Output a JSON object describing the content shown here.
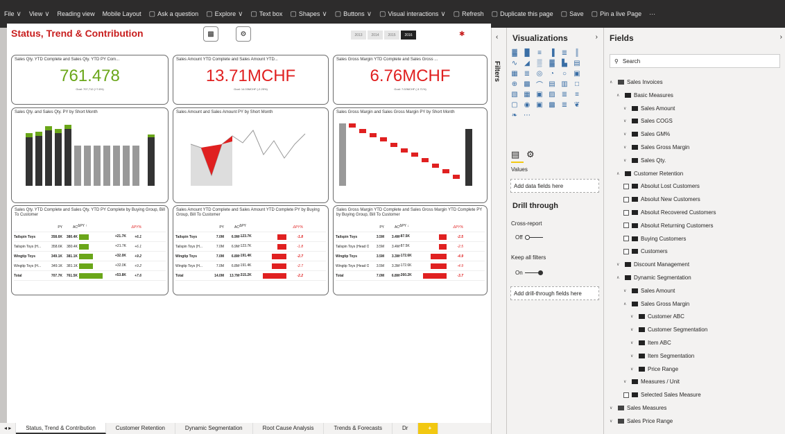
{
  "toolbar": {
    "items": [
      {
        "label": "File",
        "icon": "chevron-down"
      },
      {
        "label": "View",
        "icon": "chevron-down"
      },
      {
        "label": "Reading view"
      },
      {
        "label": "Mobile Layout"
      },
      {
        "label": "Ask a question",
        "icon": "chat"
      },
      {
        "label": "Explore",
        "icon": "explore"
      },
      {
        "label": "Text box",
        "icon": "text"
      },
      {
        "label": "Shapes",
        "icon": "shapes"
      },
      {
        "label": "Buttons",
        "icon": "buttons"
      },
      {
        "label": "Visual interactions",
        "icon": "visual"
      },
      {
        "label": "Refresh",
        "icon": "refresh"
      },
      {
        "label": "Duplicate this page",
        "icon": "duplicate"
      },
      {
        "label": "Save",
        "icon": "save"
      },
      {
        "label": "Pin a live Page",
        "icon": "pin"
      }
    ],
    "more": "···"
  },
  "report": {
    "title": "Status, Trend & Contribution",
    "years": [
      "2013",
      "2014",
      "2015",
      "2016"
    ],
    "selected_year": "2016"
  },
  "cards": [
    {
      "title": "Sales Qty. YTD Complete and Sales Qty. YTD PY Com...",
      "value": "761.478",
      "goal": "Goal: 707,712 (+7.6%)",
      "color": "g"
    },
    {
      "title": "Sales Amount YTD Complete and Sales Amount YTD...",
      "value": "13.71MCHF",
      "goal": "Goal: 14.03MCHF (-2.25%)",
      "color": "r"
    },
    {
      "title": "Sales Gross Margin YTD Complete and Sales Gross ...",
      "value": "6.76MCHF",
      "goal": "Goal: 7.02MCHF (-3.71%)",
      "color": "r"
    }
  ],
  "charts": [
    {
      "title": "Sales Qty. and Sales Qty. PY by Short Month"
    },
    {
      "title": "Sales Amount and Sales Amount PY by Short Month"
    },
    {
      "title": "Sales Gross Margin and Sales Gross Margin PY by Short Month"
    }
  ],
  "tables": [
    {
      "title": "Sales Qty. YTD Complete and Sales Qty. YTD PY Complete by Buying Group, Bill To Customer",
      "headers": [
        "",
        "PY",
        "AC",
        "ΔPY ↑",
        "ΔPY%"
      ],
      "rows": [
        [
          "Tailspin Toys",
          "358.6K",
          "380.4K",
          "+21.7K",
          "+6.1"
        ],
        [
          "Tailspin Toys (H...",
          "358.6K",
          "380.4K",
          "+21.7K",
          "+6.1"
        ],
        [
          "Wingtip Toys",
          "349.1K",
          "381.1K",
          "+32.0K",
          "+9.2"
        ],
        [
          "Wingtip Toys (H...",
          "349.1K",
          "381.1K",
          "+32.0K",
          "+9.2"
        ],
        [
          "Total",
          "707.7K",
          "761.5K",
          "+53.8K",
          "+7.6"
        ]
      ]
    },
    {
      "title": "Sales Amount YTD Complete and Sales Amount YTD Complete PY by Buying Group, Bill To Customer",
      "headers": [
        "",
        "PY",
        "AC",
        "ΔPY",
        "ΔPY%"
      ],
      "rows": [
        [
          "Tailspin Toys",
          "7.0M",
          "6.9M",
          "-123.7K",
          "-1.8"
        ],
        [
          "Tailspin Toys (H...",
          "7.0M",
          "6.9M",
          "-123.7K",
          "-1.8"
        ],
        [
          "Wingtip Toys",
          "7.0M",
          "6.8M",
          "-191.4K",
          "-2.7"
        ],
        [
          "Wingtip Toys (H...",
          "7.0M",
          "6.8M",
          "-191.4K",
          "-2.7"
        ],
        [
          "Total",
          "14.0M",
          "13.7M",
          "-315.2K",
          "-2.2"
        ]
      ]
    },
    {
      "title": "Sales Gross Margin YTD Complete and Sales Gross Margin YTD Complete PY by Buying Group, Bill To Customer",
      "headers": [
        "",
        "PY",
        "AC",
        "ΔPY ↓",
        "ΔPY%"
      ],
      "rows": [
        [
          "Tailspin Toys",
          "3.5M",
          "3.4M",
          "-87.5K",
          "-2.5"
        ],
        [
          "Tailspin Toys (Head Office)",
          "3.5M",
          "3.4M",
          "-87.5K",
          "-2.5"
        ],
        [
          "Wingtip Toys",
          "3.5M",
          "3.3M",
          "-172.6K",
          "-4.9"
        ],
        [
          "Wingtip Toys (Head Office)",
          "3.5M",
          "3.3M",
          "-172.6K",
          "-4.9"
        ],
        [
          "Total",
          "7.0M",
          "6.8M",
          "-260.2K",
          "-3.7"
        ]
      ]
    }
  ],
  "filters_label": "Filters",
  "viz": {
    "title": "Visualizations",
    "values_label": "Values",
    "add_fields": "Add data fields here",
    "drill_title": "Drill through",
    "cross_report": "Cross-report",
    "off": "Off",
    "keep_all": "Keep all filters",
    "on": "On",
    "add_drill": "Add drill-through fields here"
  },
  "fields": {
    "title": "Fields",
    "search_placeholder": "Search",
    "items": [
      {
        "label": "Sales Invoices",
        "type": "table",
        "level": 0,
        "open": true
      },
      {
        "label": "Basic Measures",
        "type": "folder",
        "level": 1,
        "open": true
      },
      {
        "label": "Sales Amount",
        "type": "folder",
        "level": 2
      },
      {
        "label": "Sales COGS",
        "type": "folder",
        "level": 2
      },
      {
        "label": "Sales GM%",
        "type": "folder",
        "level": 2
      },
      {
        "label": "Sales Gross Margin",
        "type": "folder",
        "level": 2
      },
      {
        "label": "Sales Qty.",
        "type": "folder",
        "level": 2
      },
      {
        "label": "Customer Retention",
        "type": "folder",
        "level": 1,
        "open": true
      },
      {
        "label": "Absolut Lost Customers",
        "type": "measure",
        "level": 2
      },
      {
        "label": "Absolut New Customers",
        "type": "measure",
        "level": 2
      },
      {
        "label": "Absolut Recovered Customers",
        "type": "measure",
        "level": 2
      },
      {
        "label": "Absolut Returning Customers",
        "type": "measure",
        "level": 2
      },
      {
        "label": "Buying Customers",
        "type": "measure",
        "level": 2
      },
      {
        "label": "Customers",
        "type": "measure",
        "level": 2
      },
      {
        "label": "Discount Management",
        "type": "folder",
        "level": 1
      },
      {
        "label": "Dynamic Segmentation",
        "type": "folder",
        "level": 1,
        "open": true
      },
      {
        "label": "Sales Amount",
        "type": "folder",
        "level": 2
      },
      {
        "label": "Sales Gross Margin",
        "type": "folder",
        "level": 2,
        "open": true
      },
      {
        "label": "Customer ABC",
        "type": "folder",
        "level": 3
      },
      {
        "label": "Customer Segmentation",
        "type": "folder",
        "level": 3
      },
      {
        "label": "Item ABC",
        "type": "folder",
        "level": 3
      },
      {
        "label": "Item Segmentation",
        "type": "folder",
        "level": 3
      },
      {
        "label": "Price Range",
        "type": "folder",
        "level": 3
      },
      {
        "label": "Measures / Unit",
        "type": "folder",
        "level": 2
      },
      {
        "label": "Selected Sales Measure",
        "type": "measure",
        "level": 2
      },
      {
        "label": "Sales Measures",
        "type": "table",
        "level": 0
      },
      {
        "label": "Sales Price Range",
        "type": "table",
        "level": 0
      }
    ]
  },
  "tabs": [
    "Status, Trend & Contribution",
    "Customer Retention",
    "Dynamic Segmentation",
    "Root Cause Analysis",
    "Trends & Forecasts",
    "Dr"
  ],
  "selected_tab": "Status, Trend & Contribution"
}
